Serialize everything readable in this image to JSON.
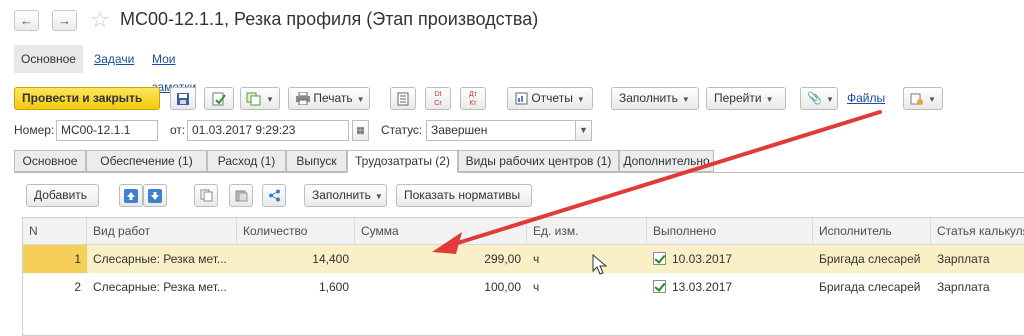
{
  "window": {
    "back_icon": "arrow-left-icon",
    "forward_icon": "arrow-right-icon",
    "favorite_icon": "star-icon",
    "title": "МС00-12.1.1, Резка профиля (Этап производства)"
  },
  "nav": {
    "items": [
      "Основное",
      "Задачи",
      "Мои заметки"
    ]
  },
  "toolbar": {
    "post_close": "Провести и закрыть",
    "print": "Печать",
    "reports": "Отчеты",
    "fill": "Заполнить",
    "goto": "Перейти",
    "files": "Файлы"
  },
  "header": {
    "number_label": "Номер:",
    "number_value": "МС00-12.1.1",
    "from_label": "от:",
    "date_value": "01.03.2017  9:29:23",
    "status_label": "Статус:",
    "status_value": "Завершен"
  },
  "tabs": [
    "Основное",
    "Обеспечение (1)",
    "Расход (1)",
    "Выпуск",
    "Трудозатраты (2)",
    "Виды рабочих центров (1)",
    "Дополнительно"
  ],
  "table_toolbar": {
    "add": "Добавить",
    "fill": "Заполнить",
    "show_norms": "Показать нормативы"
  },
  "table": {
    "columns": [
      "N",
      "Вид работ",
      "Количество",
      "Сумма",
      "Ед. изм.",
      "Выполнено",
      "Исполнитель",
      "Статья калькуляции"
    ],
    "rows": [
      {
        "n": "1",
        "work": "Слесарные: Резка мет...",
        "qty": "14,400",
        "sum": "299,00",
        "unit": "ч",
        "done": "10.03.2017",
        "executor": "Бригада слесарей",
        "article": "Зарплата"
      },
      {
        "n": "2",
        "work": "Слесарные: Резка мет...",
        "qty": "1,600",
        "sum": "100,00",
        "unit": "ч",
        "done": "13.03.2017",
        "executor": "Бригада слесарей",
        "article": "Зарплата"
      }
    ]
  },
  "colors": {
    "primary_button": "#f3c90e",
    "selected_row": "#faf0c8",
    "annotation_arrow": "#e03a3a",
    "link": "#1a4fa0"
  }
}
